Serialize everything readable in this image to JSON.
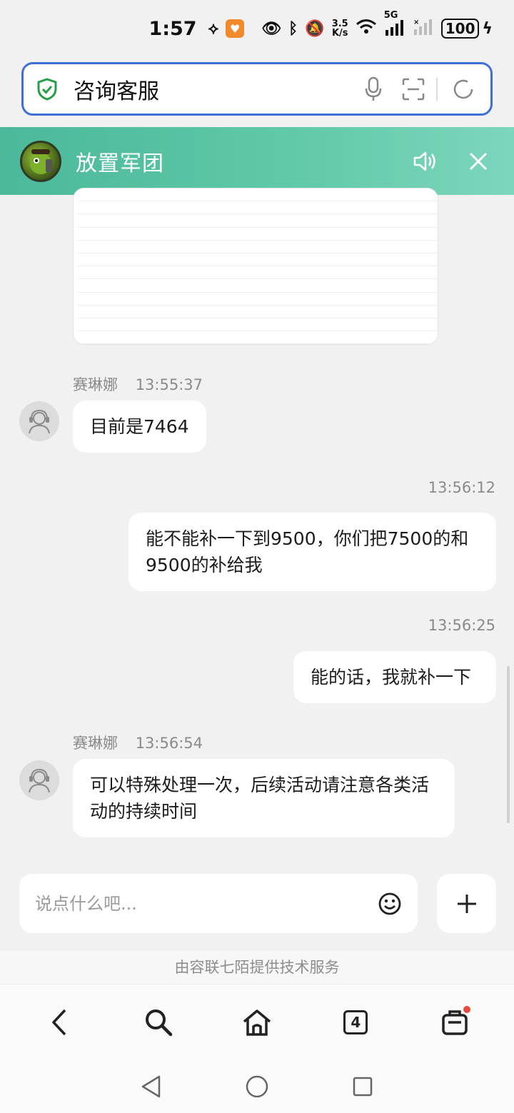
{
  "status_bar": {
    "time": "1:57",
    "net_speed_value": "3.5",
    "net_speed_unit": "K/s",
    "network_type": "5G",
    "battery": "100"
  },
  "address_bar": {
    "text": "咨询客服"
  },
  "game_header": {
    "title": "放置军团"
  },
  "chat": {
    "messages": [
      {
        "sender": "赛琳娜",
        "time": "13:55:37",
        "text": "目前是7464"
      },
      {
        "time": "13:56:12",
        "text": "能不能补一下到9500，你们把7500的和9500的补给我"
      },
      {
        "time": "13:56:25",
        "text": "能的话，我就补一下"
      },
      {
        "sender": "赛琳娜",
        "time": "13:56:54",
        "text": "可以特殊处理一次，后续活动请注意各类活动的持续时间"
      }
    ]
  },
  "input": {
    "placeholder": "说点什么吧..."
  },
  "footer": {
    "powered_by": "由容联七陌提供技术服务"
  },
  "browser_nav": {
    "tab_count": "4"
  }
}
